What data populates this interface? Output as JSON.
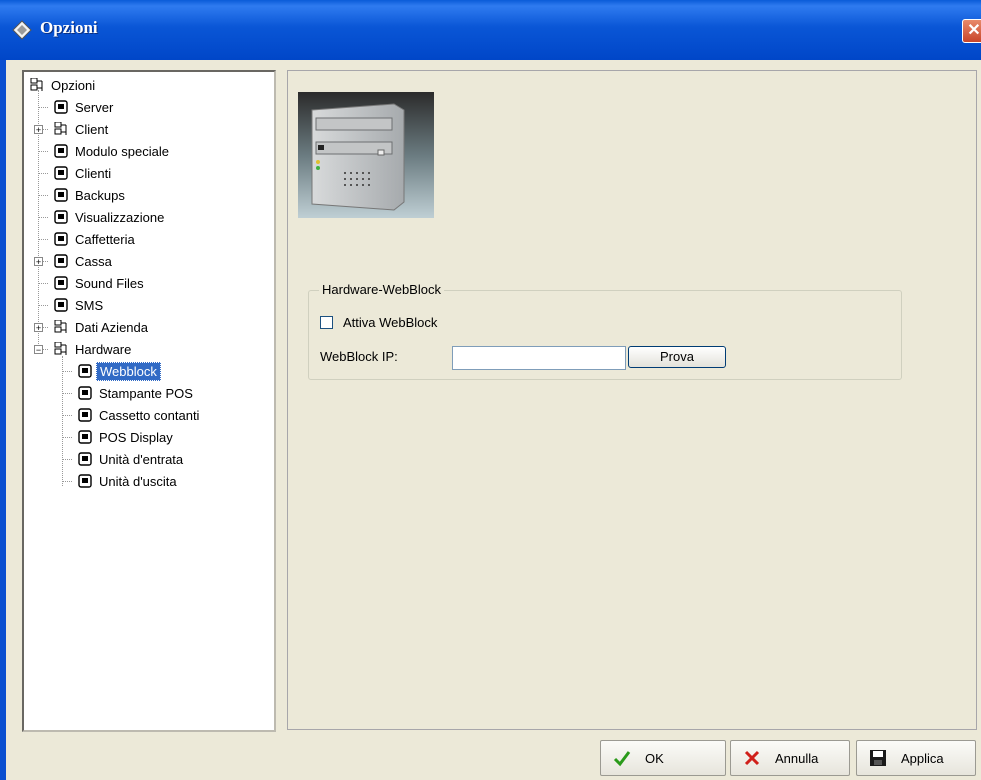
{
  "window": {
    "title": "Opzioni",
    "close_glyph": "✕",
    "app_icon": "options-diamond-icon"
  },
  "tree": {
    "root_label": "Opzioni",
    "items": [
      {
        "label": "Server",
        "icon": "page-icon"
      },
      {
        "label": "Client",
        "icon": "network-icon",
        "expander": "+"
      },
      {
        "label": "Modulo speciale",
        "icon": "page-icon"
      },
      {
        "label": "Clienti",
        "icon": "page-icon"
      },
      {
        "label": "Backups",
        "icon": "page-icon"
      },
      {
        "label": "Visualizzazione",
        "icon": "page-icon"
      },
      {
        "label": "Caffetteria",
        "icon": "page-icon"
      },
      {
        "label": "Cassa",
        "icon": "page-icon",
        "expander": "+"
      },
      {
        "label": "Sound Files",
        "icon": "page-icon"
      },
      {
        "label": "SMS",
        "icon": "page-icon"
      },
      {
        "label": "Dati Azienda",
        "icon": "network-icon",
        "expander": "+"
      },
      {
        "label": "Hardware",
        "icon": "network-icon",
        "expander": "−"
      }
    ],
    "hardware_children": [
      {
        "label": "Webblock",
        "selected": true
      },
      {
        "label": "Stampante POS"
      },
      {
        "label": "Cassetto contanti"
      },
      {
        "label": "POS Display"
      },
      {
        "label": "Unità d'entrata"
      },
      {
        "label": "Unità d'uscita"
      }
    ]
  },
  "panel": {
    "image": "hardware-server-image",
    "group_title": "Hardware-WebBlock",
    "activate_label": "Attiva WebBlock",
    "activate_checked": false,
    "ip_label": "WebBlock IP:",
    "ip_value": "",
    "test_button": "Prova"
  },
  "buttons": {
    "ok": "OK",
    "cancel": "Annulla",
    "apply": "Applica"
  },
  "colors": {
    "selection": "#316ac5",
    "titlebar": "#0a56d6",
    "dialog_bg": "#ece9d8"
  }
}
